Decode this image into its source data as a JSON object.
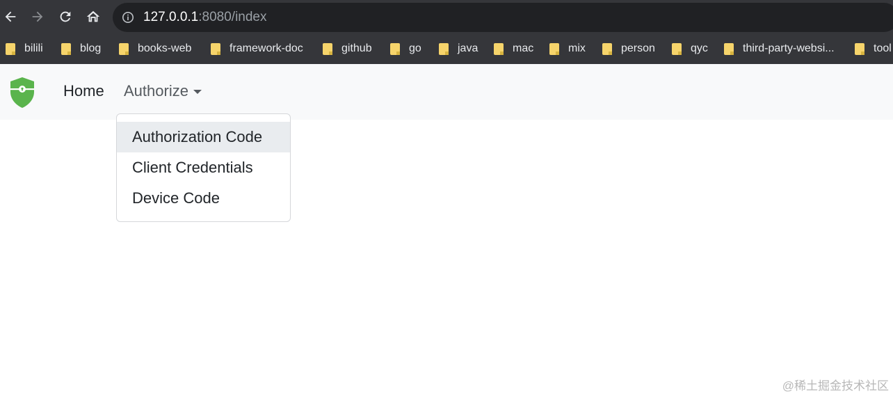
{
  "browser": {
    "url_host": "127.0.0.1",
    "url_rest": ":8080/index",
    "bookmarks": [
      {
        "label": "bilili"
      },
      {
        "label": "blog"
      },
      {
        "label": "books-web"
      },
      {
        "label": "framework-doc"
      },
      {
        "label": "github"
      },
      {
        "label": "go"
      },
      {
        "label": "java"
      },
      {
        "label": "mac"
      },
      {
        "label": "mix"
      },
      {
        "label": "person"
      },
      {
        "label": "qyc"
      },
      {
        "label": "third-party-websi..."
      },
      {
        "label": "tool"
      }
    ]
  },
  "navbar": {
    "home_label": "Home",
    "authorize_label": "Authorize",
    "dropdown_items": [
      {
        "label": "Authorization Code"
      },
      {
        "label": "Client Credentials"
      },
      {
        "label": "Device Code"
      }
    ]
  },
  "colors": {
    "brand_green": "#5ab44c",
    "chrome_bg": "#35363a",
    "navbar_bg": "#f8f9fa"
  },
  "watermark": "@稀土掘金技术社区"
}
